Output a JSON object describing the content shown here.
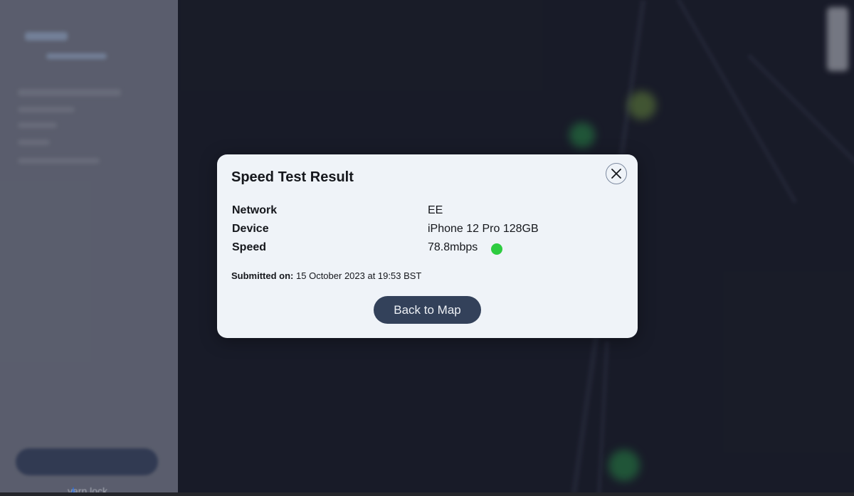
{
  "sidebar": {
    "bottom_label": "yarn lock"
  },
  "modal": {
    "title": "Speed Test Result",
    "close_label": "×",
    "rows": [
      {
        "label": "Network",
        "value": "EE"
      },
      {
        "label": "Device",
        "value": "iPhone 12 Pro 128GB"
      },
      {
        "label": "Speed",
        "value": "78.8mbps"
      }
    ],
    "speed_status_color": "#2ecc40",
    "submitted_prefix": "Submitted on:",
    "submitted_value": "15 October 2023 at 19:53 BST",
    "back_button_label": "Back to Map"
  },
  "map": {
    "hotspot_color": "#2ecc40"
  }
}
